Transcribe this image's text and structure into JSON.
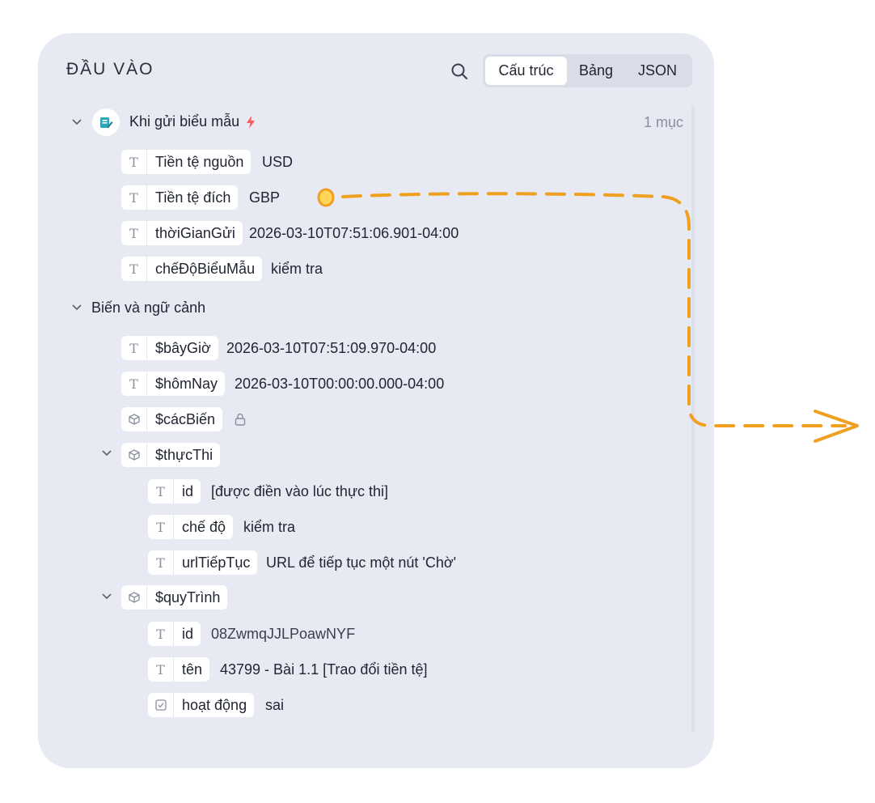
{
  "panel": {
    "title": "ĐẦU VÀO",
    "tabs": [
      "Cấu trúc",
      "Bảng",
      "JSON"
    ],
    "active_tab": "Cấu trúc"
  },
  "trigger": {
    "label": "Khi gửi biểu mẫu",
    "count": "1 mục",
    "fields": [
      {
        "type_icon": "T",
        "key": "Tiền tệ nguồn",
        "value": "USD"
      },
      {
        "type_icon": "T",
        "key": "Tiền tệ đích",
        "value": "GBP"
      },
      {
        "type_icon": "T",
        "key": "thờiGianGửi",
        "value": "2026-03-10T07:51:06.901-04:00"
      },
      {
        "type_icon": "T",
        "key": "chếĐộBiểuMẫu",
        "value": "kiểm tra"
      }
    ]
  },
  "context": {
    "label": "Biến và ngữ cảnh",
    "vars": [
      {
        "type_icon": "T",
        "key": "$bâyGiờ",
        "value": "2026-03-10T07:51:09.970-04:00"
      },
      {
        "type_icon": "T",
        "key": "$hômNay",
        "value": "2026-03-10T00:00:00.000-04:00"
      },
      {
        "type_icon": "cube",
        "key": "$cácBiến",
        "value": ""
      }
    ],
    "execution": {
      "key": "$thựcThi",
      "children": [
        {
          "type_icon": "T",
          "key": "id",
          "value": "[được điền vào lúc thực thi]"
        },
        {
          "type_icon": "T",
          "key": "chế độ",
          "value": "kiểm tra"
        },
        {
          "type_icon": "T",
          "key": "urlTiếpTục",
          "value": "URL để tiếp tục một nút 'Chờ'"
        }
      ]
    },
    "workflow": {
      "key": "$quyTrình",
      "children": [
        {
          "type_icon": "T",
          "key": "id",
          "value": "08ZwmqJJLPoawNYF"
        },
        {
          "type_icon": "T",
          "key": "tên",
          "value": "43799 - Bài 1.1 [Trao đổi tiền tệ]"
        },
        {
          "type_icon": "checkbox",
          "key": "hoạt động",
          "value": "sai"
        }
      ]
    }
  },
  "colors": {
    "panel_bg": "#e7eaf3",
    "accent_orange": "#f0a020",
    "bolt": "#ff5a5f",
    "muted_text": "#8a8f9c"
  }
}
